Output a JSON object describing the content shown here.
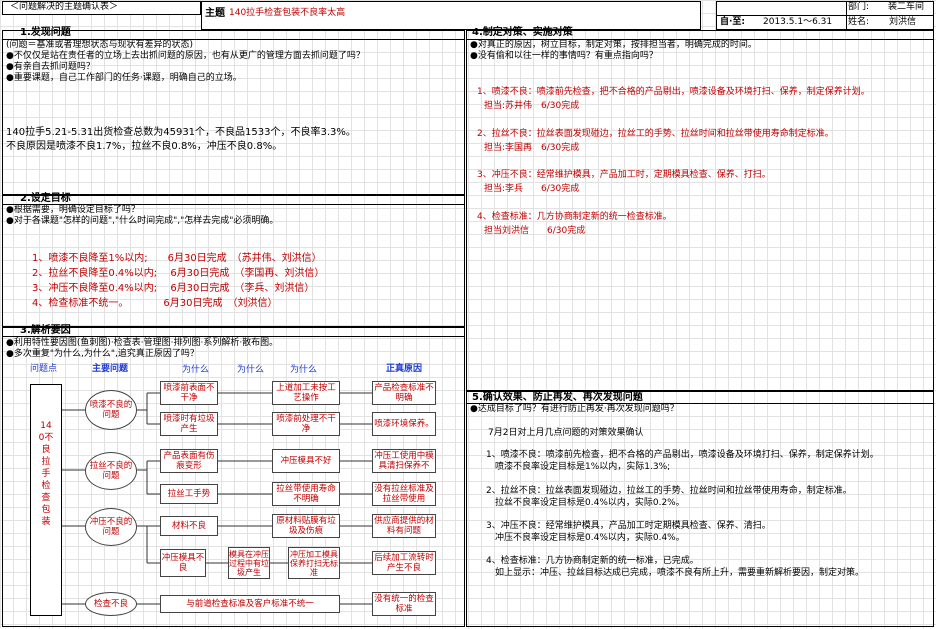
{
  "header": {
    "form_title": "＜问题解决的主题确认表＞",
    "subject_label": "主题",
    "subject_value": "140拉手检查包装不良率太高",
    "dept_label": "部门:",
    "dept_value": "装二车间",
    "period_label": "自·至:",
    "period_value": "2013.5.1～6.31",
    "name_label": "姓名:",
    "name_value": "刘洪信"
  },
  "s1": {
    "title": "1.发现问题",
    "def": "(问题＝基准或者理想状态与现状有差异的状态)",
    "q1": "●不仅仅是站在责任者的立场上去出抓问题的原因，也有从更广的管理方面去抓问题了吗？",
    "q2": "●有亲自去抓问题吗？",
    "q3": "●重要课题，自己工作部门的任务·课题，明确自己的立场。",
    "p1": "140拉手5.21-5.31出货检查总数为45931个，不良品1533个，不良率3.3%。",
    "p2": "不良原因是喷漆不良1.7%，拉丝不良0.8%，冲压不良0.8%。"
  },
  "s2": {
    "title": "2.设定目标",
    "q1": "●根据需要，明确设定目标了吗？",
    "q2": "●对于各课题\"怎样的问题\",\"什么时间完成\",\"怎样去完成\"必须明确。",
    "goals": [
      "1、喷漆不良降至1%以内;　　6月30日完成　（苏井伟、刘洪信）",
      "2、拉丝不良降至0.4%以内;　 6月30日完成　（李国再、刘洪信）",
      "3、冲压不良降至0.4%以内;　 6月30日完成　（李兵、刘洪信）",
      "4、检查标准不统一。　　　　6月30日完成　（刘洪信）"
    ]
  },
  "s3": {
    "title": "3.解析要因",
    "q1": "●利用特性要因图(鱼刺图)·检查表·管理图·排列图·系列解析·散布图。",
    "q2": "●多次重复\"为什么,为什么\",追究真正原因了吗？",
    "col_problem": "问题点",
    "col_main": "主要问题",
    "col_why1": "为什么",
    "col_why2": "为什么",
    "col_why3": "为什么",
    "col_true": "正真原因",
    "problem_text": "140不良拉手检查包装",
    "ovals": [
      "喷漆不良的问题",
      "拉丝不良的问题",
      "冲压不良的问题",
      "检查不良"
    ],
    "why1": [
      "喷漆前表面不干净",
      "喷漆时有垃圾产生",
      "产品表面有伤痕变形",
      "拉丝工手势",
      "材料不良",
      "冲压模具不良"
    ],
    "why2": [
      "上道加工未按工艺操作",
      "喷漆前处理不干净",
      "冲压模具不好",
      "拉丝带使用寿命不明确",
      "原材料贴膜有垃圾及伤痕",
      "模具在冲压过程中有垃圾产生",
      "冲压加工模具保养打扫无标准"
    ],
    "true_causes": [
      "产品检查标准不明确",
      "喷漆环境保养。",
      "冲压工使用中模具清扫保养不",
      "没有拉丝标准及拉丝带使用",
      "供应商提供的材料有问题",
      "后续加工流转时产生不良",
      "没有统一的检查标准"
    ],
    "bottom_row": "与前道检查标准及客户标准不统一"
  },
  "s4": {
    "title": "4.制定对策、实施对策",
    "q1": "●对真正的原因，树立目标，制定对策，按排担当者，明确完成的时间。",
    "q2": "●没有偷和以往一样的事情吗？有重点指向吗？",
    "items": [
      "1、喷漆不良：喷漆前先检查，把不合格的产品剔出，喷漆设备及环境打扫、保养，制定保养计划。",
      "担当:苏井伟　6/30完成",
      "2、拉丝不良：拉丝表面发现碰边，拉丝工的手势、拉丝时间和拉丝带使用寿命制定标准。",
      "担当:李国再　6/30完成",
      "3、冲压不良：经常维护模具，产品加工时，定期模具检查、保养、打扫。",
      "担当:李兵　　6/30完成",
      "4、检查标准：几方协商制定新的统一检查标准。",
      "担当刘洪信　　6/30完成"
    ]
  },
  "s5": {
    "title": "5.确认效果、防止再发、再次发现问题",
    "q1": "●达成目标了吗？有进行防止再发·再次发现问题吗？",
    "lines": [
      "7月2日对上月几点问题的对策效果确认",
      "1、喷漆不良：喷漆前先检查，把不合格的产品剔出，喷漆设备及环境打扫、保养，制定保养计划。",
      "喷漆不良率设定目标是1%以内，实际1.3%;",
      "2、拉丝不良：拉丝表面发现碰边，拉丝工的手势、拉丝时间和拉丝带使用寿命，制定标准。",
      "拉丝不良率设定目标是0.4%以内，实际0.2%。",
      "3、冲压不良：经常维护模具，产品加工时定期模具检查、保养、清扫。",
      "冲压不良率设定目标是0.4%以内，实际0.4%。",
      "4、检查标准：几方协商制定新的统一标准，已完成。",
      "如上显示：冲压、拉丝目标达成已完成，喷漆不良有所上升，需要重新解析要因，制定对策。"
    ]
  }
}
